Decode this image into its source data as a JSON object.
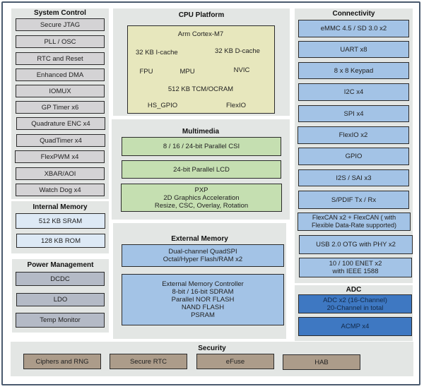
{
  "system_control": {
    "title": "System Control",
    "items": [
      "Secure JTAG",
      "PLL / OSC",
      "RTC and Reset",
      "Enhanced DMA",
      "IOMUX",
      "GP Timer x6",
      "Quadrature ENC x4",
      "QuadTimer x4",
      "FlexPWM x4",
      "XBAR/AOI",
      "Watch Dog x4"
    ]
  },
  "internal_memory": {
    "title": "Internal Memory",
    "items": [
      "512 KB SRAM",
      "128 KB ROM"
    ]
  },
  "power_management": {
    "title": "Power Management",
    "items": [
      "DCDC",
      "LDO",
      "Temp Monitor"
    ]
  },
  "cpu_platform": {
    "title": "CPU Platform",
    "core": "Arm Cortex-M7",
    "icache": "32 KB I-cache",
    "dcache": "32 KB D-cache",
    "fpu": "FPU",
    "mpu": "MPU",
    "nvic": "NVIC",
    "tcm": "512 KB TCM/OCRAM",
    "hs_gpio": "HS_GPIO",
    "flexio": "FlexIO"
  },
  "multimedia": {
    "title": "Multimedia",
    "items": [
      "8 / 16 / 24-bit Parallel CSI",
      "24-bit Parallel LCD",
      "PXP\n2D Graphics Acceleration\nResize, CSC, Overlay, Rotation"
    ]
  },
  "external_memory": {
    "title": "External Memory",
    "items": [
      "Dual-channel QuadSPI\nOctal/Hyper Flash/RAM x2",
      "External Memory Controller\n8-bit / 16-bit SDRAM\nParallel NOR FLASH\nNAND FLASH\nPSRAM"
    ]
  },
  "connectivity": {
    "title": "Connectivity",
    "items": [
      "eMMC 4.5 / SD 3.0 x2",
      "UART x8",
      "8 x 8 Keypad",
      "I2C x4",
      "SPI x4",
      "FlexIO x2",
      "GPIO",
      "I2S / SAI x3",
      "S/PDIF Tx / Rx",
      "FlexCAN x2  + FlexCAN ( with\nFlexible Data-Rate supported)",
      "USB 2.0 OTG with PHY x2",
      "10 / 100 ENET x2\nwith IEEE 1588"
    ]
  },
  "adc": {
    "title": "ADC",
    "items": [
      "ADC x2 (16-Channel)\n20-Channel in total",
      "ACMP x4"
    ]
  },
  "security": {
    "title": "Security",
    "items": [
      "Ciphers and RNG",
      "Secure RTC",
      "eFuse",
      "HAB"
    ]
  }
}
